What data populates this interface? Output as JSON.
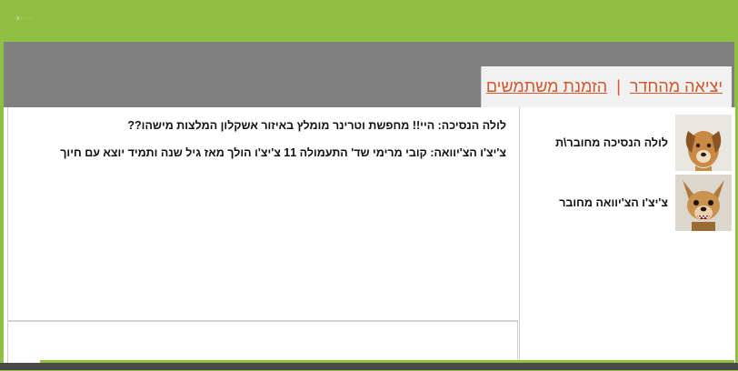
{
  "header": {
    "logo_text": "≡·· ··"
  },
  "menu": {
    "exit_label": "יציאה מהחדר",
    "separator": "|",
    "invite_label": "הזמנת משתמשים"
  },
  "chat": {
    "messages": [
      {
        "text": "לולה הנסיכה: היי!! מחפשת וטרינר מומלץ באיזור אשקלון המלצות מישהו??"
      },
      {
        "text": "צ'יצ'ו הצ'יוואה: קובי מרימי שד' התעמולה 11 צ'יצ'ו הולך מאז גיל שנה ותמיד יוצא עם חיוך"
      }
    ],
    "input_placeholder": ""
  },
  "users": [
    {
      "name": "לולה הנסיכה מחובר\\ת",
      "avatar": "dog-avatar-lola"
    },
    {
      "name": "צ'יצ'ו הצ'יוואה מחובר",
      "avatar": "dog-avatar-chichu"
    }
  ],
  "colors": {
    "brand_green": "#8fc043",
    "gray_band": "#808080",
    "link_orange": "#d4572c"
  }
}
